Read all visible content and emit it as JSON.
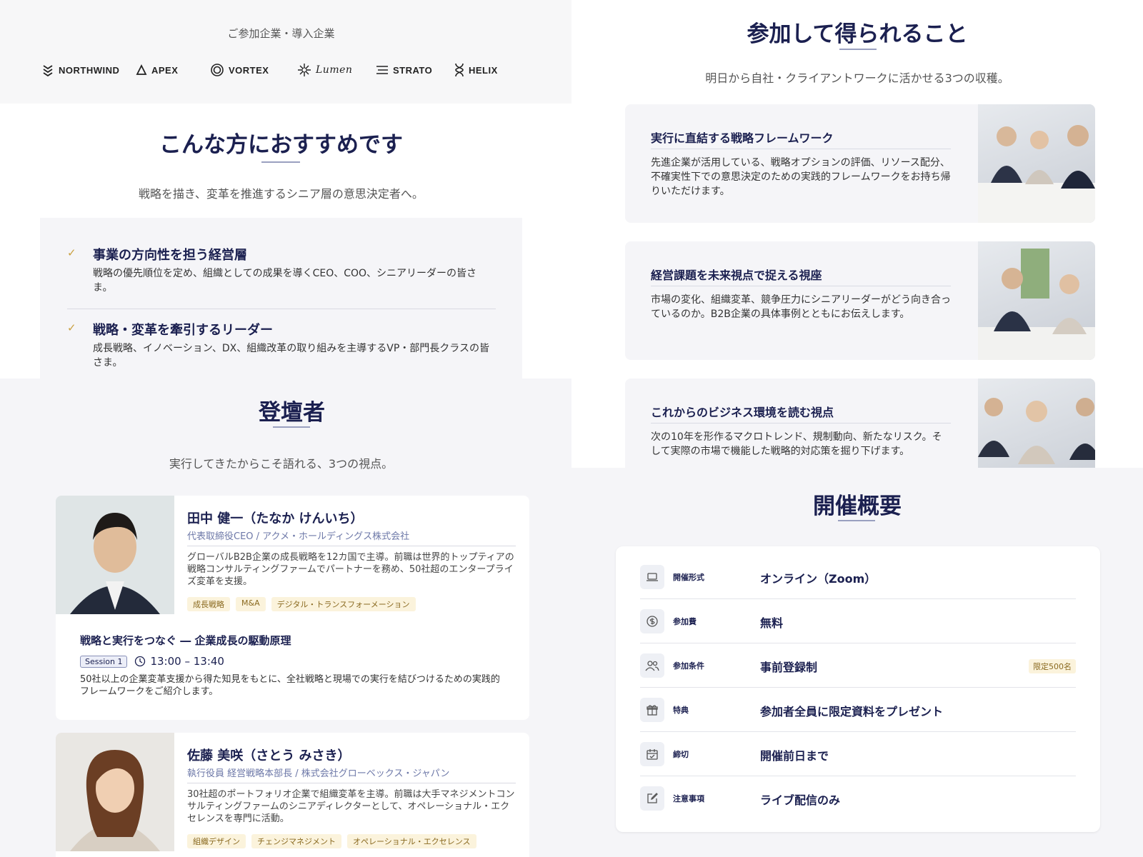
{
  "logos": {
    "caption": "ご参加企業・導入企業",
    "items": [
      {
        "name": "NORTHWIND",
        "icon": "chevrons-icon"
      },
      {
        "name": "APEX",
        "icon": "triangle-icon"
      },
      {
        "name": "VORTEX",
        "icon": "target-icon"
      },
      {
        "name": "Lumen",
        "icon": "sun-icon"
      },
      {
        "name": "STRATO",
        "icon": "lines-icon"
      },
      {
        "name": "HELIX",
        "icon": "helix-icon"
      }
    ]
  },
  "recommend": {
    "title": "こんな方におすすめです",
    "subtitle": "戦略を描き、変革を推進するシニア層の意思決定者へ。",
    "items": [
      {
        "title": "事業の方向性を担う経営層",
        "desc": "戦略の優先順位を定め、組織としての成果を導くCEO、COO、シニアリーダーの皆さま。"
      },
      {
        "title": "戦略・変革を牽引するリーダー",
        "desc": "成長戦略、イノベーション、DX、組織改革の取り組みを主導するVP・部門長クラスの皆さま。"
      }
    ]
  },
  "benefits": {
    "title": "参加して得られること",
    "subtitle": "明日から自社・クライアントワークに活かせる3つの収穫。",
    "items": [
      {
        "title": "実行に直結する戦略フレームワーク",
        "desc": "先進企業が活用している、戦略オプションの評価、リソース配分、不確実性下での意思決定のための実践的フレームワークをお持ち帰りいただけます。"
      },
      {
        "title": "経営課題を未来視点で捉える視座",
        "desc": "市場の変化、組織変革、競争圧力にシニアリーダーがどう向き合っているのか。B2B企業の具体事例とともにお伝えします。"
      },
      {
        "title": "これからのビジネス環境を読む視点",
        "desc": "次の10年を形作るマクロトレンド、規制動向、新たなリスク。そして実際の市場で機能した戦略的対応策を掘り下げます。"
      }
    ]
  },
  "speakers": {
    "title": "登壇者",
    "subtitle": "実行してきたからこそ語れる、3つの視点。",
    "items": [
      {
        "name": "田中 健一（たなか けんいち）",
        "role": "代表取締役CEO / アクメ・ホールディングス株式会社",
        "bio": "グローバルB2B企業の成長戦略を12カ国で主導。前職は世界的トップティアの戦略コンサルティングファームでパートナーを務め、50社超のエンタープライズ変革を支援。",
        "tags": [
          "成長戦略",
          "M&A",
          "デジタル・トランスフォーメーション"
        ],
        "session_title": "戦略と実行をつなぐ ― 企業成長の駆動原理",
        "session_label": "Session 1",
        "session_time": "13:00 – 13:40",
        "session_desc": "50社以上の企業変革支援から得た知見をもとに、全社戦略と現場での実行を結びつけるための実践的フレームワークをご紹介します。"
      },
      {
        "name": "佐藤 美咲（さとう みさき）",
        "role": "執行役員 経営戦略本部長 / 株式会社グローベックス・ジャパン",
        "bio": "30社超のポートフォリオ企業で組織変革を主導。前職は大手マネジメントコンサルティングファームのシニアディレクターとして、オペレーショナル・エクセレンスを専門に活動。",
        "tags": [
          "組織デザイン",
          "チェンジマネジメント",
          "オペレーショナル・エクセレンス"
        ]
      }
    ]
  },
  "overview": {
    "title": "開催概要",
    "rows": [
      {
        "label": "開催形式",
        "value": "オンライン（Zoom）",
        "icon": "laptop-icon"
      },
      {
        "label": "参加費",
        "value": "無料",
        "icon": "dollar-icon"
      },
      {
        "label": "参加条件",
        "value": "事前登録制",
        "badge": "限定500名",
        "icon": "users-icon"
      },
      {
        "label": "特典",
        "value": "参加者全員に限定資料をプレゼント",
        "icon": "gift-icon"
      },
      {
        "label": "締切",
        "value": "開催前日まで",
        "icon": "calendar-icon"
      },
      {
        "label": "注意事項",
        "value": "ライブ配信のみ",
        "icon": "edit-icon"
      }
    ]
  },
  "colors": {
    "navy": "#1b2050",
    "gold": "#c9a040",
    "tag_bg": "#fbf3dc",
    "panel_bg": "#f5f5f8"
  }
}
